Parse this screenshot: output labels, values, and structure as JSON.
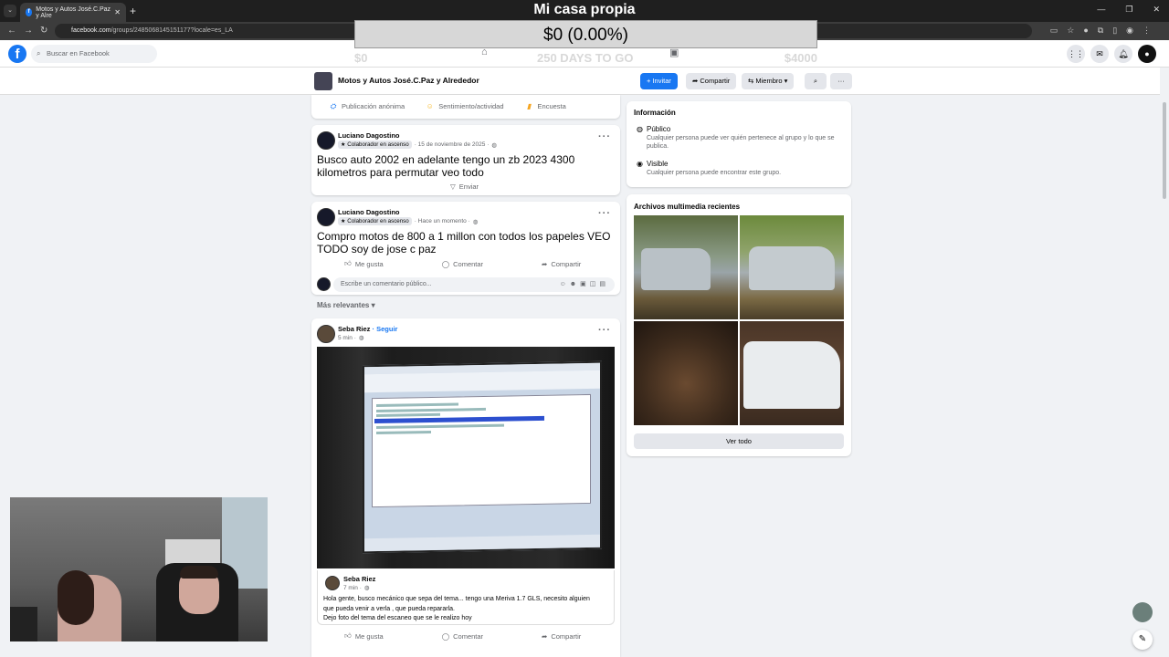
{
  "browser": {
    "tab_title": "Motos y Autos José.C.Paz y Alre",
    "tab_close": "✕",
    "new_tab": "+",
    "url_host": "facebook.com",
    "url_path": "/groups/2485068145151177?locale=es_LA"
  },
  "overlay": {
    "title": "Mi casa propia",
    "value": "$0 (0.00%)",
    "stat_left": "$0",
    "stat_mid": "250 DAYS TO GO",
    "stat_right": "$4000"
  },
  "fb": {
    "logo": "f",
    "search_placeholder": "Buscar en Facebook"
  },
  "group": {
    "name": "Motos y Autos José.C.Paz y Alrededor",
    "invite": "+ Invitar",
    "share": "Compartir",
    "member": "Miembro ▾"
  },
  "composer": {
    "anon": "Publicación anónima",
    "feeling": "Sentimiento/actividad",
    "poll": "Encuesta"
  },
  "posts": [
    {
      "author": "Luciano Dagostino",
      "badge": "Colaborador en ascenso",
      "time": "· 15 de noviembre de 2025 ·",
      "text": "Busco auto 2002 en adelante tengo un zb 2023 4300 kilometros para permutar veo todo",
      "send": "Enviar"
    },
    {
      "author": "Luciano Dagostino",
      "badge": "Colaborador en ascenso",
      "time": "· Hace un momento ·",
      "text": "Compro motos de 800 a 1 millon con todos los papeles VEO TODO soy de jose c paz",
      "like": "Me gusta",
      "comment": "Comentar",
      "share": "Compartir",
      "comment_placeholder": "Escribe un comentario público..."
    }
  ],
  "sort_label": "Más relevantes ▾",
  "post3": {
    "author": "Seba Riez",
    "follow": "· Seguir",
    "time": "5 min ·",
    "shared_author": "Seba Riez",
    "shared_time": "7 min ·",
    "shared_text_1": "Hola gente, busco mecánico que sepa del tema... tengo una Meriva 1.7 GLS, necesito alguien",
    "shared_text_2": "que pueda venir a verla , que pueda repararla.",
    "shared_text_3": "Dejo foto del tema del escaneo que se le realizo hoy",
    "like": "Me gusta",
    "comment": "Comentar",
    "share": "Compartir"
  },
  "info": {
    "title": "Información",
    "public_title": "Público",
    "public_desc": "Cualquier persona puede ver quién pertenece al grupo y lo que se publica.",
    "visible_title": "Visible",
    "visible_desc": "Cualquier persona puede encontrar este grupo."
  },
  "media": {
    "title": "Archivos multimedia recientes",
    "see_all": "Ver todo"
  },
  "colors": {
    "fb_blue": "#1877f2",
    "page_bg": "#f0f2f5"
  }
}
